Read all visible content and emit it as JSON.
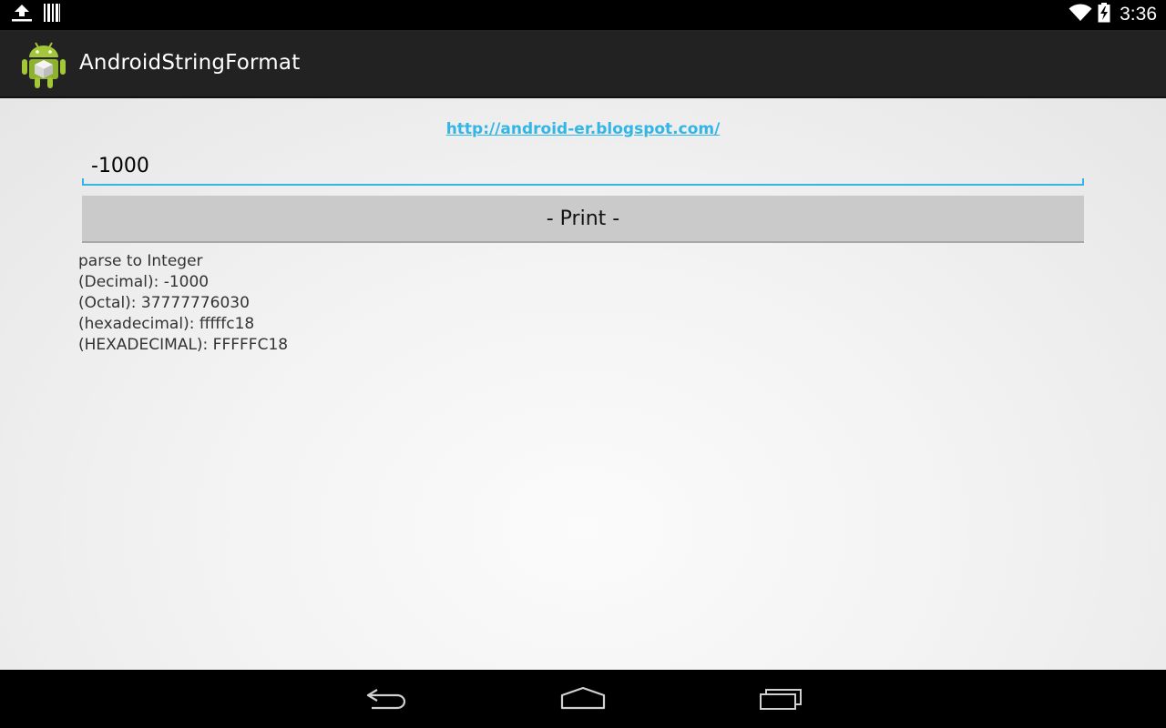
{
  "status_bar": {
    "time": "3:36",
    "icons": [
      "upload-icon",
      "barcode-icon",
      "wifi-icon",
      "battery-charging-icon"
    ]
  },
  "action_bar": {
    "title": "AndroidStringFormat",
    "icon": "android-app-icon"
  },
  "main": {
    "link": "http://android-er.blogspot.com/",
    "input_value": "-1000",
    "button_label": "- Print -",
    "output_lines": [
      "parse to Integer",
      "(Decimal): -1000",
      "(Octal): 37777776030",
      "(hexadecimal): fffffc18",
      "(HEXADECIMAL): FFFFFC18"
    ]
  },
  "nav_bar": {
    "buttons": [
      "back-icon",
      "home-icon",
      "recent-apps-icon"
    ]
  },
  "colors": {
    "accent": "#33b5e5",
    "action_bar": "#222222",
    "button": "#cacaca"
  }
}
